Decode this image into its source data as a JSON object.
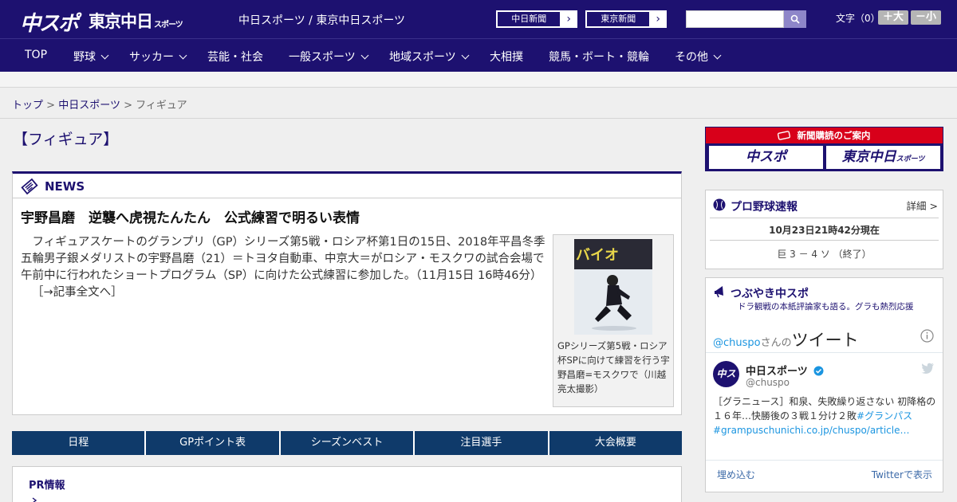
{
  "header": {
    "logo_chuspo": "中スポ",
    "logo_tokyo": "東京中日",
    "logo_tokyo_sub": "スポーツ",
    "site_names": "中日スポーツ / 東京中日スポーツ",
    "ext_links": [
      {
        "label": "中日新聞",
        "arrow": "›"
      },
      {
        "label": "東京新聞",
        "arrow": "›"
      }
    ],
    "search_placeholder": "",
    "font_label": "文字（0）",
    "font_larger": "＋大",
    "font_smaller": "－小"
  },
  "nav": {
    "items": [
      {
        "label": "TOP"
      },
      {
        "label": "野球"
      },
      {
        "label": "サッカー"
      },
      {
        "label": "芸能・社会"
      },
      {
        "label": "一般スポーツ"
      },
      {
        "label": "地域スポーツ"
      },
      {
        "label": "大相撲"
      },
      {
        "label": "競馬・ボート・競輪"
      },
      {
        "label": "その他"
      }
    ]
  },
  "breadcrumb": {
    "top": "トップ",
    "sep": ">",
    "section": "中日スポーツ",
    "current": "フィギュア"
  },
  "page_title": "【フィギュア】",
  "news": {
    "label": "NEWS",
    "headline": "宇野昌磨　逆襲へ虎視たんたん　公式練習で明るい表情",
    "body": "　フィギュアスケートのグランプリ（GP）シリーズ第5戦・ロシア杯第1日の15日、2018年平昌冬季五輪男子銀メダリストの宇野昌磨（21）＝トヨタ自動車、中京大＝がロシア・モスクワの試合会場で午前中に行われたショートプログラム（SP）に向けた公式練習に参加した。（11月15日 16時46分）",
    "more": "［→記事全文へ］",
    "photo_caption": "GPシリーズ第5戦・ロシア杯SPに向けて練習を行う宇野昌磨=モスクワで（川越亮太撮影）",
    "photo_text": "バイオ"
  },
  "tabs": [
    {
      "label": "日程"
    },
    {
      "label": "GPポイント表"
    },
    {
      "label": "シーズンベスト"
    },
    {
      "label": "注目選手"
    },
    {
      "label": "大会概要"
    }
  ],
  "pr": {
    "title": "PR情報"
  },
  "sidebar": {
    "subscribe_banner": "新聞購読のご案内",
    "sub_logo_1": "中スポ",
    "sub_logo_2": "東京中日",
    "sub_logo_2_small": "スポーツ",
    "baseball": {
      "title": "プロ野球速報",
      "detail": "詳細 >",
      "time": "10月23日21時42分現在",
      "score": "巨 3 － 4 ソ （終了）"
    },
    "tweets": {
      "title": "つぶやき中スポ",
      "subtitle": "ドラ観戦の本紙評論家も語る。グラも熱烈応援",
      "handle_prefix": "@chuspo",
      "handle_suffix": "さんの",
      "heading": "ツイート",
      "name": "中日スポーツ",
      "handle": "@chuspo",
      "text_plain": "［グラニュース］和泉、失敗繰り返さない 初降格の１６年…快勝後の３戦１分け２敗",
      "text_link1": "#グランパス",
      "text_link2": "#grampuschunichi.co.jp/chuspo/article…",
      "embed": "埋め込む",
      "view_on_twitter": "Twitterで表示"
    }
  },
  "colors": {
    "brand_navy": "#1d1170",
    "tab_navy": "#0f3a6a",
    "accent_red": "#d8001a",
    "twitter_blue": "#1b95e0"
  }
}
